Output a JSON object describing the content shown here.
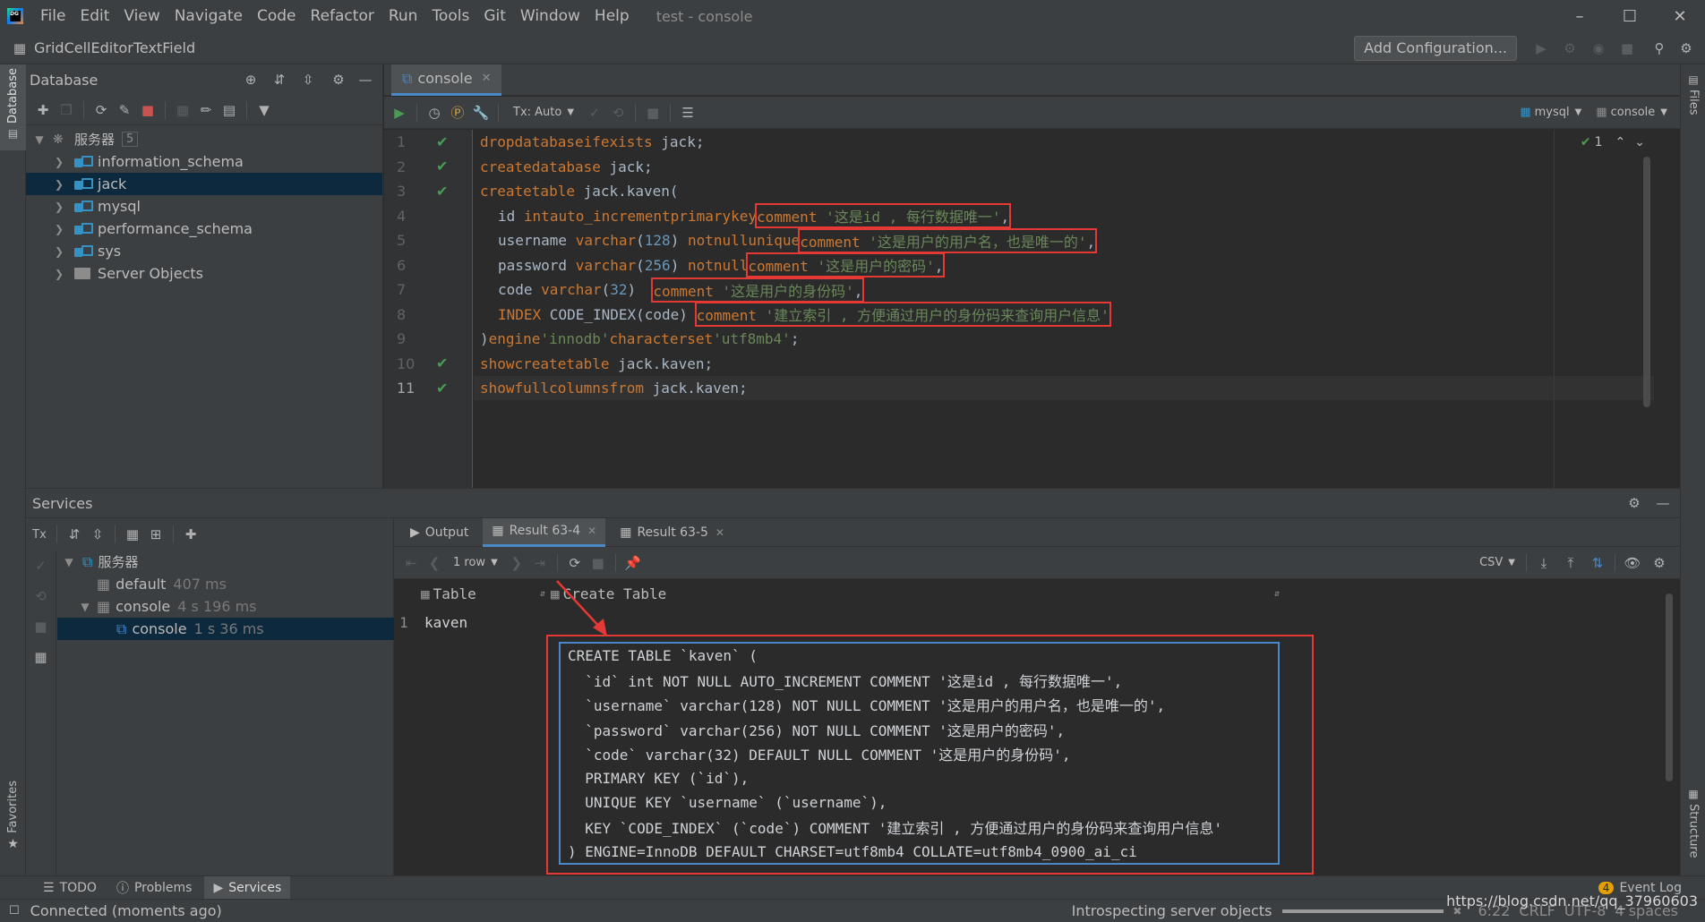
{
  "app": {
    "title": "test - console",
    "menus": [
      "File",
      "Edit",
      "View",
      "Navigate",
      "Code",
      "Refactor",
      "Run",
      "Tools",
      "Git",
      "Window",
      "Help"
    ],
    "project": "GridCellEditorTextField",
    "add_config": "Add Configuration..."
  },
  "database_panel": {
    "title": "Database",
    "root_label": "服务器",
    "root_count": "5",
    "schemas": [
      "information_schema",
      "jack",
      "mysql",
      "performance_schema",
      "sys"
    ],
    "server_objects": "Server Objects"
  },
  "editor": {
    "tab": "console",
    "tx_mode": "Tx: Auto",
    "datasource": "mysql",
    "session": "console",
    "inspection_count": "1",
    "line_numbers": [
      "1",
      "2",
      "3",
      "4",
      "5",
      "6",
      "7",
      "8",
      "9",
      "10",
      "11"
    ],
    "lines": [
      "drop database if exists jack;",
      "create database jack;",
      "create table jack.kaven(",
      "id int auto_increment  primary key comment '这是id , 每行数据唯一',",
      "username varchar(128) not null  unique comment '这是用户的用户名，也是唯一的',",
      "password varchar(256) not null comment '这是用户的密码',",
      "code varchar(32)  comment '这是用户的身份码',",
      "INDEX CODE_INDEX(code) comment '建立索引 , 方便通过用户的身份码来查询用户信息'",
      ")engine 'innodb' character set 'utf8mb4';",
      "show create table jack.kaven;",
      "show full columns from jack.kaven;"
    ]
  },
  "services": {
    "title": "Services",
    "tree": [
      {
        "label": "服务器",
        "time": ""
      },
      {
        "label": "default",
        "time": "407 ms"
      },
      {
        "label": "console",
        "time": "4 s 196 ms"
      },
      {
        "label": "console",
        "time": "1 s 36 ms"
      }
    ],
    "tabs": [
      "Output",
      "Result 63-4",
      "Result 63-5"
    ],
    "rows_label": "1 row",
    "export_format": "CSV",
    "columns": [
      "Table",
      "Create Table"
    ],
    "row_number": "1",
    "table_value": "kaven",
    "ddl_lines": [
      "CREATE TABLE `kaven` (",
      "  `id` int NOT NULL AUTO_INCREMENT COMMENT '这是id , 每行数据唯一',",
      "  `username` varchar(128) NOT NULL COMMENT '这是用户的用户名，也是唯一的',",
      "  `password` varchar(256) NOT NULL COMMENT '这是用户的密码',",
      "  `code` varchar(32) DEFAULT NULL COMMENT '这是用户的身份码',",
      "  PRIMARY KEY (`id`),",
      "  UNIQUE KEY `username` (`username`),",
      "  KEY `CODE_INDEX` (`code`) COMMENT '建立索引 , 方便通过用户的身份码来查询用户信息'",
      ") ENGINE=InnoDB DEFAULT CHARSET=utf8mb4 COLLATE=utf8mb4_0900_ai_ci"
    ]
  },
  "tool_windows": [
    "TODO",
    "Problems",
    "Services"
  ],
  "event_log": "Event Log",
  "event_count": "4",
  "status": {
    "left": "Connected (moments ago)",
    "progress_text": "Introspecting server objects",
    "position": "6:22",
    "line_sep": "CRLF",
    "encoding": "UTF-8",
    "indent": "4 spaces",
    "watermark": "https://blog.csdn.net/qq_37960603"
  },
  "side_labels": {
    "database": "Database",
    "favorites": "Favorites",
    "files": "Files",
    "structure": "Structure"
  },
  "colors": {
    "accent": "#4a88c7",
    "highlight_box": "#e53935",
    "check": "#499c54",
    "keyword": "#cc7832",
    "string": "#6a8759",
    "number": "#6897bb"
  }
}
